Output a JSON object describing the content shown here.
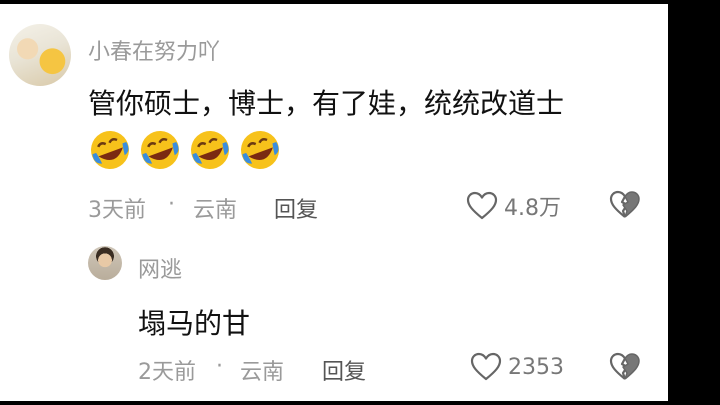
{
  "comments": [
    {
      "username": "小春在努力吖",
      "text": "管你硕士，博士，有了娃，统统改道士",
      "emoji_icons": [
        "rofl-emoji",
        "rofl-emoji",
        "rofl-emoji",
        "rofl-emoji"
      ],
      "time": "3天前",
      "separator": "·",
      "location": "云南",
      "reply_label": "回复",
      "likes": "4.8万"
    },
    {
      "username": "网逃",
      "text": "塌马的甘",
      "time": "2天前",
      "separator": "·",
      "location": "云南",
      "reply_label": "回复",
      "likes": "2353"
    }
  ],
  "icons": {
    "like": "heart-outline-icon",
    "dislike": "broken-heart-icon"
  },
  "colors": {
    "background": "#ffffff",
    "username": "#9a9a9a",
    "text": "#111111",
    "emoji_face": "#f7c21b",
    "emoji_tears": "#3a8dde"
  }
}
